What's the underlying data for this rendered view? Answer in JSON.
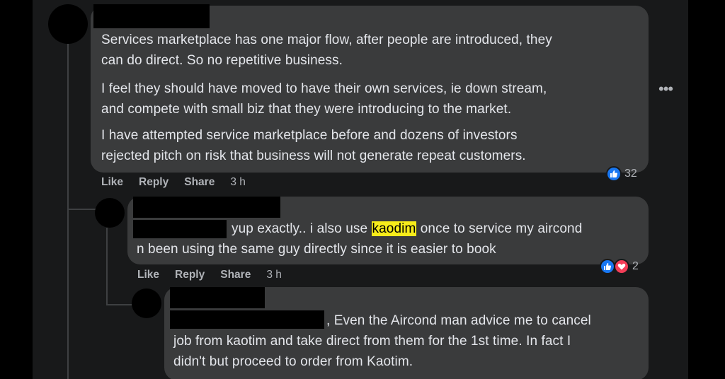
{
  "comment1": {
    "para1": "Services marketplace has one major flow, after people are introduced, they",
    "para1b": "can do direct. So no repetitive business.",
    "para2": "I feel they should have moved to have their own services, ie down stream,",
    "para2b": "and compete with small biz that they were introducing to the market.",
    "para3": "I have attempted service marketplace before and dozens of investors",
    "para3b": "rejected pitch on risk that business will not generate repeat customers.",
    "actions": {
      "like": "Like",
      "reply": "Reply",
      "share": "Share",
      "time": "3 h"
    },
    "reactions": {
      "count": "32"
    },
    "more": "•••"
  },
  "comment2": {
    "line1_pre": "yup exactly.. i also use ",
    "line1_hl": "kaodim",
    "line1_post": " once to service my aircond",
    "line2": "n been using the same guy directly since it is easier to book",
    "actions": {
      "like": "Like",
      "reply": "Reply",
      "share": "Share",
      "time": "3 h"
    },
    "reactions": {
      "count": "2"
    }
  },
  "comment3": {
    "line1": ", Even the Aircond man advice me to cancel",
    "line2": "job from kaotim and take direct from them for the 1st time. In fact I",
    "line3": "didn't but proceed to order from Kaotim."
  },
  "colors": {
    "bubble": "#3a3b3c",
    "panel": "#18191a",
    "text": "#e4e6eb",
    "muted": "#b0b3b8",
    "like_blue": "#1877f2",
    "heart_red": "#f33e58",
    "highlight": "#f7ec1a"
  }
}
